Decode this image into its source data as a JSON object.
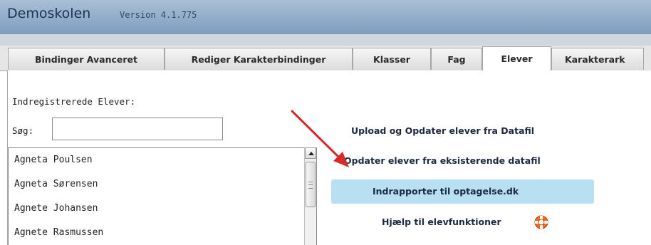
{
  "header": {
    "title": "Demoskolen",
    "version": "Version 4.1.775"
  },
  "tabs": [
    {
      "label": "Bindinger Avanceret",
      "active": false
    },
    {
      "label": "Rediger Karakterbindinger",
      "active": false
    },
    {
      "label": "Klasser",
      "active": false
    },
    {
      "label": "Fag",
      "active": false
    },
    {
      "label": "Elever",
      "active": true
    },
    {
      "label": "Karakterark",
      "active": false
    }
  ],
  "students": {
    "heading": "Indregistrerede Elever:",
    "search_label": "Søg:",
    "search_value": "",
    "items": [
      "Agneta Poulsen",
      "Agneta Sørensen",
      "Agnete Johansen",
      "Agnete Rasmussen"
    ]
  },
  "actions": {
    "upload": "Upload og Opdater elever fra Datafil",
    "update": "Opdater elever fra eksisterende datafil",
    "report": "Indrapporter til optagelse.dk",
    "help": "Hjælp til elevfunktioner"
  },
  "icons": {
    "help": "lifebuoy-icon",
    "annotation": "red-arrow-icon"
  },
  "colors": {
    "header": "#8ea9c6",
    "highlight": "#b9dff3",
    "arrow": "#d42b2b",
    "lifebuoy": "#f26a1b"
  }
}
